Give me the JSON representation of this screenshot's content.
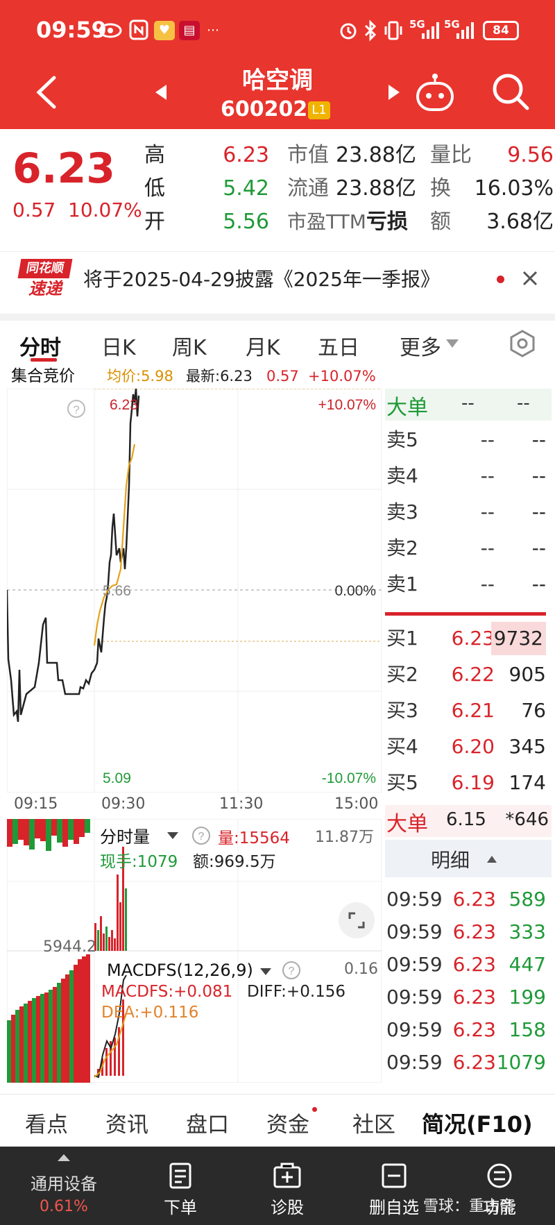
{
  "status_bar": {
    "time": "09:59",
    "signal1": "5G",
    "signal2": "5G",
    "battery": "84"
  },
  "header": {
    "name": "哈空调",
    "code": "600202",
    "level_badge": "L1"
  },
  "summary": {
    "price": "6.23",
    "change": "0.57",
    "change_pct": "10.07%",
    "high_label": "高",
    "high": "6.23",
    "low_label": "低",
    "low": "5.42",
    "open_label": "开",
    "open": "5.56",
    "mktcap_label": "市值",
    "mktcap": "23.88亿",
    "float_label": "流通",
    "float": "23.88亿",
    "pe_label": "市盈TTM",
    "pe": "亏损",
    "vol_ratio_label": "量比",
    "vol_ratio": "9.56",
    "turnover_label": "换",
    "turnover": "16.03%",
    "amount_label": "额",
    "amount": "3.68亿"
  },
  "notice": {
    "logo_top": "同花顺",
    "logo_bottom": "速递",
    "text": "将于2025-04-29披露《2025年一季报》"
  },
  "tabs": [
    "分时",
    "日K",
    "周K",
    "月K",
    "五日",
    "更多"
  ],
  "chart_header": {
    "auction": "集合竞价",
    "avg": "均价:5.98",
    "latest": "最新:6.23",
    "chg": "0.57",
    "pct": "+10.07%"
  },
  "main_chart": {
    "top_price": "6.23",
    "top_pct": "+10.07%",
    "mid_price": "5.66",
    "mid_pct": "0.00%",
    "bottom_price": "5.09",
    "bottom_pct": "-10.07%",
    "help": "?",
    "times": [
      "09:15",
      "09:30",
      "11:30",
      "15:00"
    ]
  },
  "volume_panel": {
    "selector": "分时量",
    "vol_label": "量:15564",
    "hand_label": "现手:1079",
    "amount_label": "额:969.5万",
    "max_label": "11.87万",
    "left_value": "5944.2"
  },
  "macd_panel": {
    "selector": "MACDFS(12,26,9)",
    "macdfs": "MACDFS:+0.081",
    "diff": "DIFF:+0.156",
    "dea": "DEA:+0.116",
    "max_label": "0.16"
  },
  "order_book": {
    "big_order_label": "大单",
    "placeholder": "--",
    "asks": [
      {
        "label": "卖5",
        "price": "--",
        "vol": "--"
      },
      {
        "label": "卖4",
        "price": "--",
        "vol": "--"
      },
      {
        "label": "卖3",
        "price": "--",
        "vol": "--"
      },
      {
        "label": "卖2",
        "price": "--",
        "vol": "--"
      },
      {
        "label": "卖1",
        "price": "--",
        "vol": "--"
      }
    ],
    "bids": [
      {
        "label": "买1",
        "price": "6.23",
        "vol": "9732"
      },
      {
        "label": "买2",
        "price": "6.22",
        "vol": "905"
      },
      {
        "label": "买3",
        "price": "6.21",
        "vol": "76"
      },
      {
        "label": "买4",
        "price": "6.20",
        "vol": "345"
      },
      {
        "label": "买5",
        "price": "6.19",
        "vol": "174"
      }
    ],
    "big_order_bottom": {
      "label": "大单",
      "price": "6.15",
      "vol": "*646"
    },
    "detail_label": "明细",
    "ticks": [
      {
        "time": "09:59",
        "price": "6.23",
        "vol": "589"
      },
      {
        "time": "09:59",
        "price": "6.23",
        "vol": "333"
      },
      {
        "time": "09:59",
        "price": "6.23",
        "vol": "447"
      },
      {
        "time": "09:59",
        "price": "6.23",
        "vol": "199"
      },
      {
        "time": "09:59",
        "price": "6.23",
        "vol": "158"
      },
      {
        "time": "09:59",
        "price": "6.23",
        "vol": "1079"
      }
    ]
  },
  "subnav": [
    "看点",
    "资讯",
    "盘口",
    "资金",
    "社区",
    "简况(F10)"
  ],
  "bottom_bar": {
    "settings_label": "通用设备",
    "settings_value": "0.61%",
    "items": [
      "下单",
      "诊股",
      "删自选",
      "功能"
    ],
    "watermark": "雪球：重古斋"
  },
  "colors": {
    "header": "#e8352e",
    "up": "#d8232a",
    "down": "#1f9a38",
    "avg_line": "#d99000"
  }
}
